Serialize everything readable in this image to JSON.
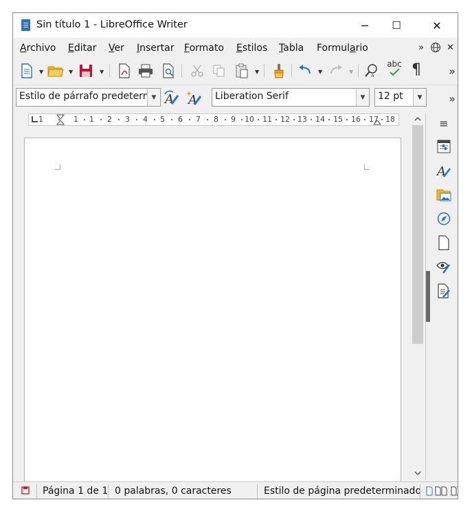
{
  "window": {
    "title": "Sin título 1 - LibreOffice Writer",
    "controls": {
      "minimize": "─",
      "maximize": "☐",
      "close": "✕"
    }
  },
  "menubar": {
    "items": [
      {
        "label": "Archivo",
        "accel": "A",
        "rest": "rchivo"
      },
      {
        "label": "Editar",
        "accel": "E",
        "rest": "ditar"
      },
      {
        "label": "Ver",
        "accel": "V",
        "rest": "er"
      },
      {
        "label": "Insertar",
        "accel": "I",
        "rest": "nsertar"
      },
      {
        "label": "Formato",
        "accel": "F",
        "rest": "ormato"
      },
      {
        "label": "Estilos",
        "accel": "E",
        "rest": "stilos"
      },
      {
        "label": "Tabla",
        "accel": "T",
        "rest": "abla"
      },
      {
        "label": "Formulario",
        "prefix": "Formul",
        "accel": "a",
        "rest": "rio"
      }
    ],
    "overflow": "»",
    "close_doc": "✕"
  },
  "toolbar_standard": {
    "icons": [
      "new-document-icon",
      "open-folder-icon",
      "save-icon",
      "export-pdf-icon",
      "print-icon",
      "print-preview-icon",
      "cut-icon",
      "copy-icon",
      "paste-icon",
      "clone-formatting-icon",
      "undo-icon",
      "redo-icon",
      "find-replace-icon",
      "spelling-icon",
      "formatting-marks-icon"
    ],
    "spelling_label": "abc",
    "pilcrow": "¶",
    "overflow": "»"
  },
  "toolbar_formatting": {
    "paragraph_style": "Estilo de párrafo predeterm",
    "font_name": "Liberation Serif",
    "font_size": "12 pt",
    "overflow": "»"
  },
  "ruler": {
    "labels": [
      "1",
      "1",
      "1",
      "2",
      "3",
      "4",
      "5",
      "6",
      "7",
      "8",
      "9",
      "10",
      "11",
      "12",
      "13",
      "14",
      "15",
      "16",
      "17",
      "18"
    ]
  },
  "sidebar": {
    "menu_icon": "≡",
    "icons": [
      "properties-icon",
      "styles-icon",
      "gallery-icon",
      "navigator-icon",
      "page-icon",
      "style-inspector-icon",
      "manage-changes-icon"
    ]
  },
  "statusbar": {
    "page": "Página 1 de 1",
    "words": "0 palabras, 0 caracteres",
    "page_style": "Estilo de página predeterminado"
  },
  "colors": {
    "accent": "#2a6fc9",
    "save_red": "#c8102e",
    "folder": "#f0b429",
    "paste_brush": "#e8a317"
  }
}
